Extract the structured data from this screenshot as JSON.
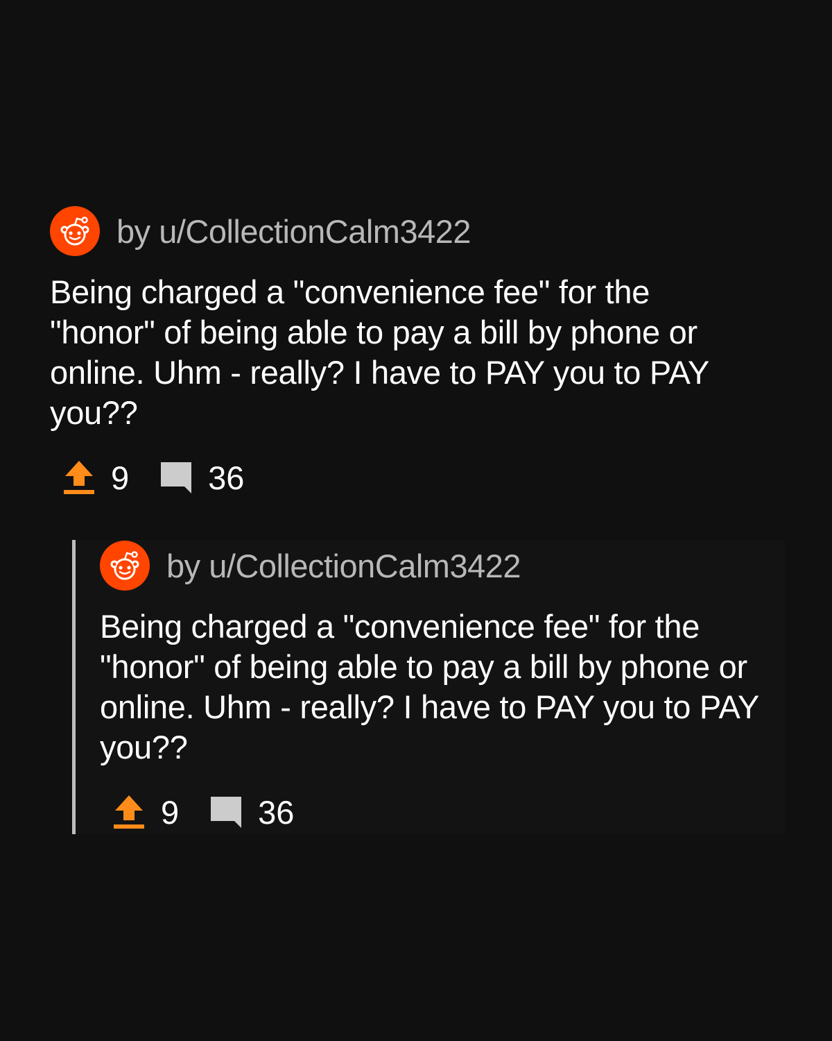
{
  "colors": {
    "background": "#101010",
    "brand": "#ff4500",
    "upvote": "#ff8c1a",
    "author_text": "#b8b8b8",
    "quote_bar": "#bdbdbd",
    "comment_icon": "#cccccc"
  },
  "icons": {
    "avatar": "reddit-snoo-icon",
    "upvote": "upvote-arrow-icon",
    "comments": "comment-bubble-icon"
  },
  "post": {
    "author": "by u/CollectionCalm3422",
    "body": "Being charged a \"convenience fee\" for the \"honor\" of being able to pay a bill by phone or online. Uhm - really? I have to PAY you to PAY you??",
    "upvotes": "9",
    "comments": "36"
  },
  "quoted_post": {
    "author": "by u/CollectionCalm3422",
    "body": "Being charged a \"convenience fee\" for the \"honor\" of being able to pay a bill by phone or online. Uhm - really? I have to PAY you to PAY you??",
    "upvotes": "9",
    "comments": "36"
  }
}
